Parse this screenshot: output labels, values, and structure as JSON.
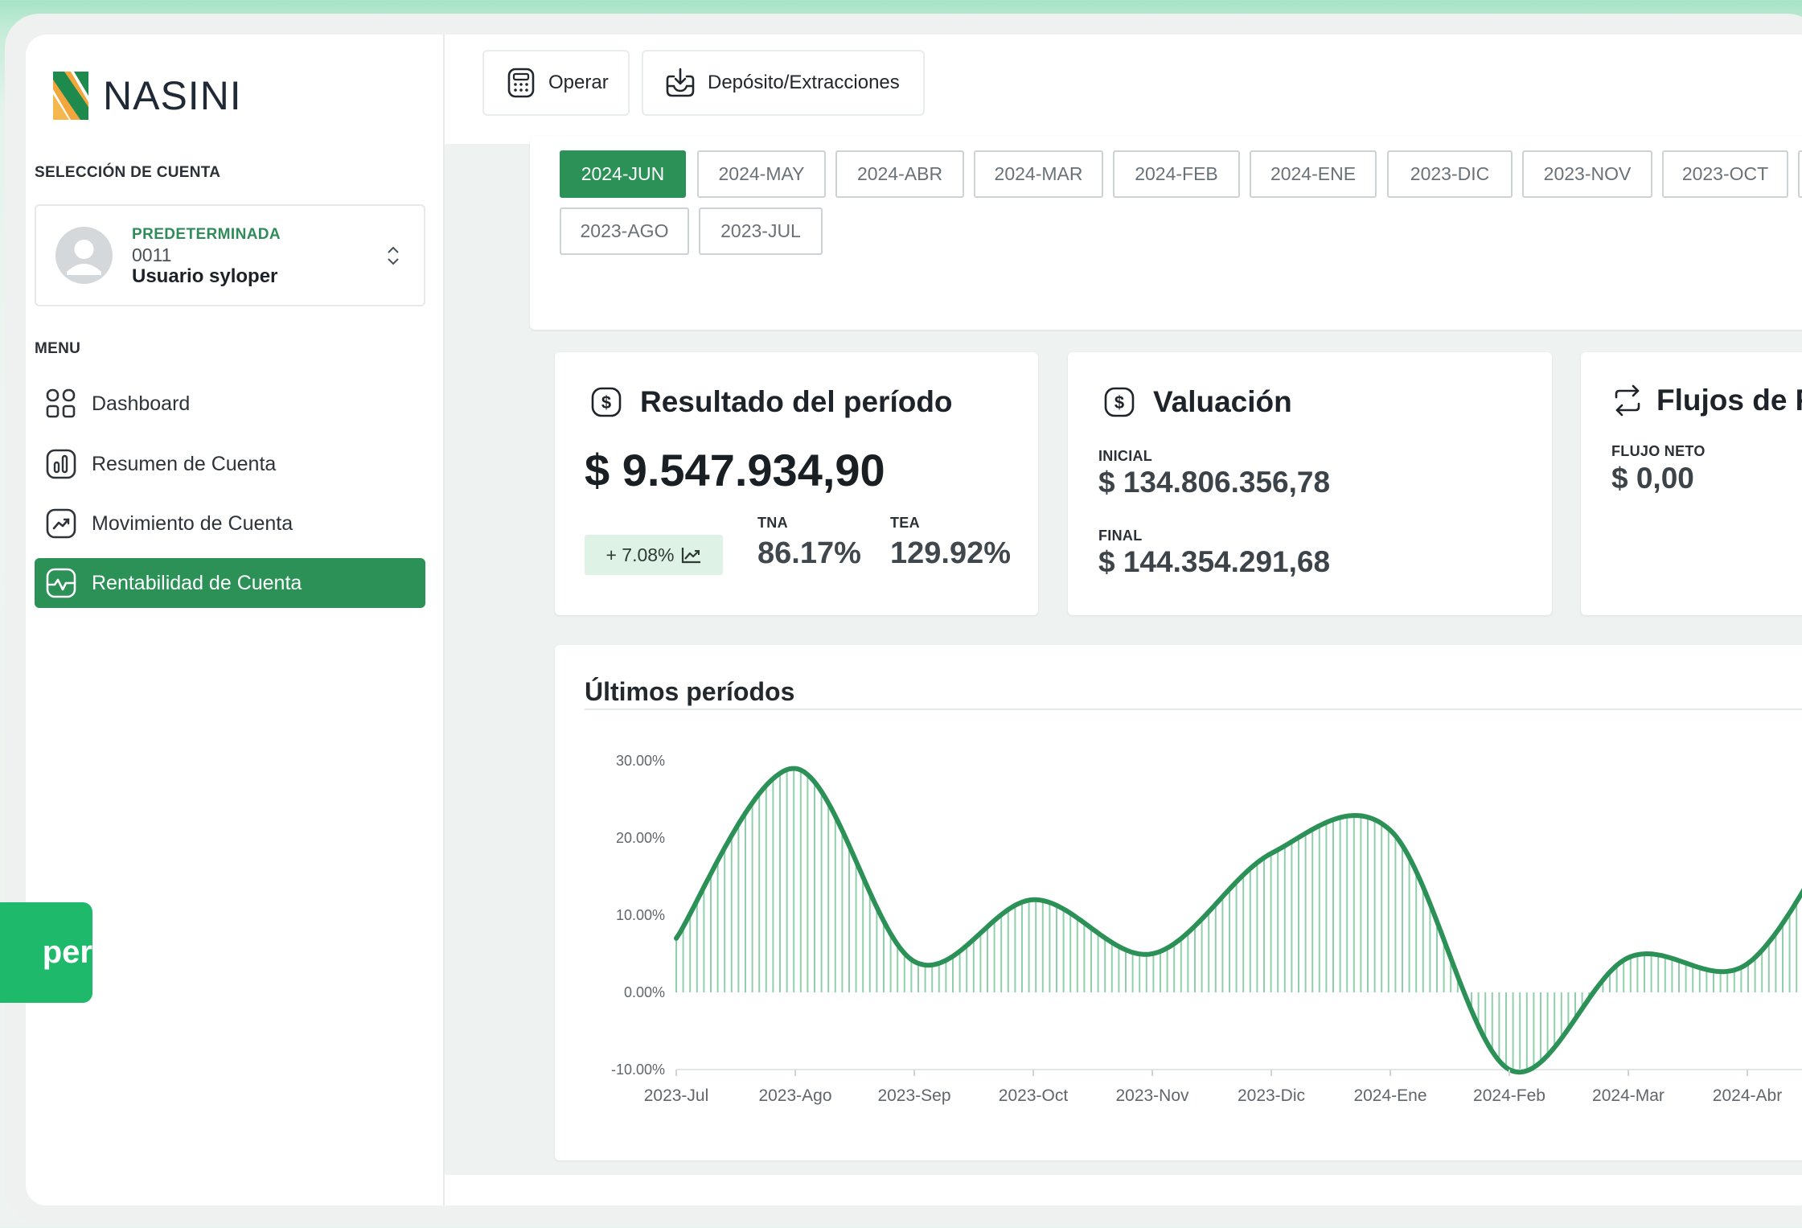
{
  "brand": {
    "name": "NASINI"
  },
  "sidebar": {
    "account_section_label": "SELECCIÓN DE CUENTA",
    "account": {
      "tag": "PREDETERMINADA",
      "number": "0011",
      "user": "Usuario syloper"
    },
    "menu_label": "MENU",
    "items": [
      {
        "label": "Dashboard",
        "icon": "grid-icon",
        "active": false
      },
      {
        "label": "Resumen de Cuenta",
        "icon": "bar-chart-icon",
        "active": false
      },
      {
        "label": "Movimiento de Cuenta",
        "icon": "trend-icon",
        "active": false
      },
      {
        "label": "Rentabilidad de Cuenta",
        "icon": "pulse-icon",
        "active": true
      }
    ]
  },
  "toolbar": {
    "operar_label": "Operar",
    "deposito_label": "Depósito/Extracciones"
  },
  "periods": {
    "selected": "2024-JUN",
    "items": [
      "2024-JUN",
      "2024-MAY",
      "2024-ABR",
      "2024-MAR",
      "2024-FEB",
      "2024-ENE",
      "2023-DIC",
      "2023-NOV",
      "2023-OCT",
      "2023-AGO",
      "2023-JUL"
    ]
  },
  "resultado": {
    "title": "Resultado del período",
    "amount": "$ 9.547.934,90",
    "change": "+ 7.08%",
    "tna_label": "TNA",
    "tna_value": "86.17%",
    "tea_label": "TEA",
    "tea_value": "129.92%"
  },
  "valuacion": {
    "title": "Valuación",
    "inicial_label": "INICIAL",
    "inicial_value": "$ 134.806.356,78",
    "final_label": "FINAL",
    "final_value": "$ 144.354.291,68"
  },
  "flujos": {
    "title": "Flujos de Fo",
    "neto_label": "FLUJO NETO",
    "neto_value": "$ 0,00"
  },
  "chart_data": {
    "type": "area",
    "title": "Últimos períodos",
    "xlabel": "",
    "ylabel": "",
    "categories": [
      "2023-Jul",
      "2023-Ago",
      "2023-Sep",
      "2023-Oct",
      "2023-Nov",
      "2023-Dic",
      "2024-Ene",
      "2024-Feb",
      "2024-Mar",
      "2024-Abr"
    ],
    "x_positions": [
      0,
      1,
      2,
      3,
      4,
      5,
      6,
      7,
      8,
      9
    ],
    "values": [
      7.0,
      29.0,
      4.0,
      12.0,
      5.0,
      18.0,
      21.0,
      -10.0,
      4.5,
      3.7
    ],
    "y_ticks": [
      "30.00%",
      "20.00%",
      "10.00%",
      "0.00%",
      "-10.00%"
    ],
    "ylim": [
      -10,
      30
    ],
    "grid": false,
    "line_color": "#2b9157",
    "fill_color": "#8fd0aa"
  },
  "float_badge": {
    "text": "per"
  },
  "colors": {
    "accent": "#2b9157",
    "accent_light": "#dff2e6",
    "badge": "#1fb96b"
  }
}
